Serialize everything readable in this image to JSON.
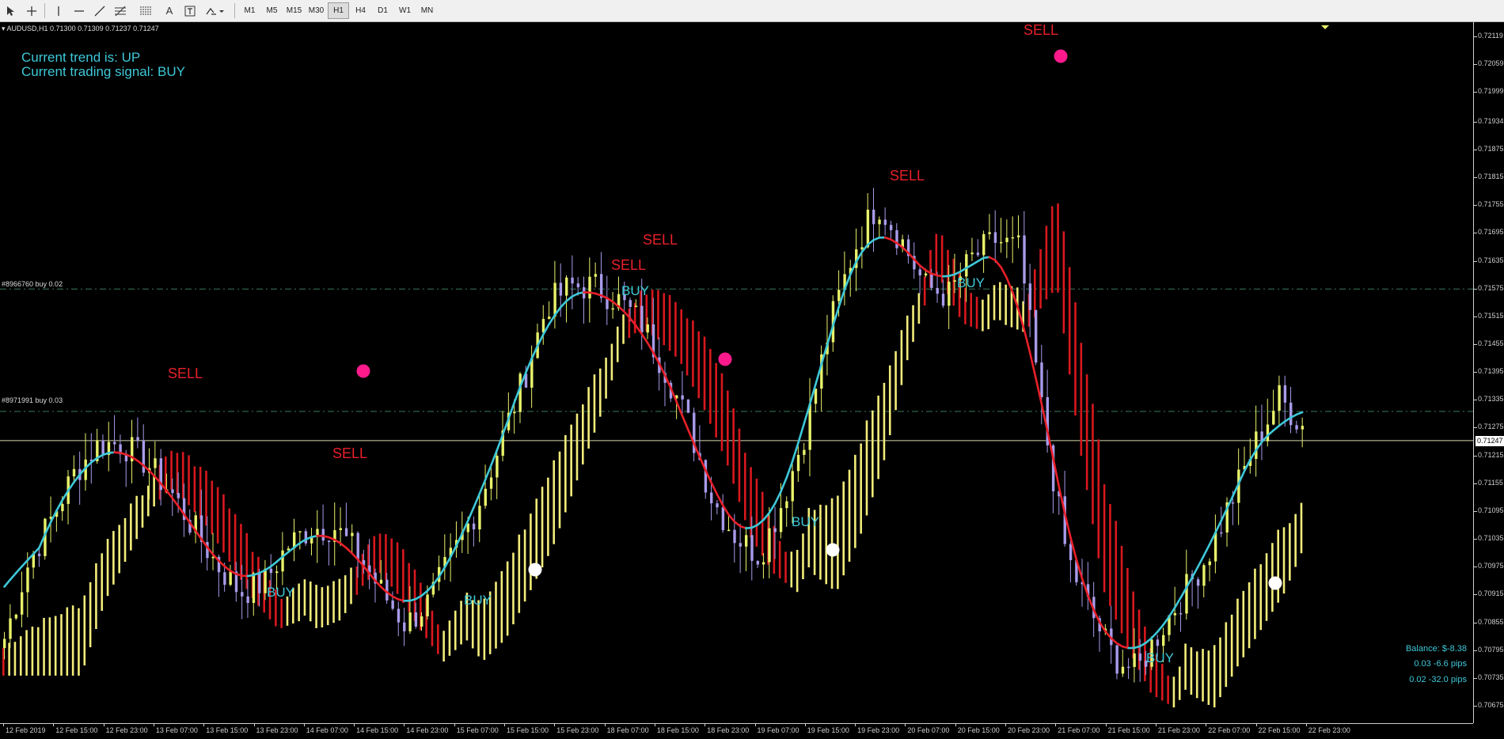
{
  "toolbar": {
    "tools": [
      "cursor-icon",
      "crosshair-icon",
      "vertical-line-icon",
      "horizontal-line-icon",
      "trendline-icon",
      "fibonacci-icon",
      "channel-icon",
      "text-icon",
      "text-label-icon",
      "shapes-icon"
    ],
    "timeframes": [
      "M1",
      "M5",
      "M15",
      "M30",
      "H1",
      "H4",
      "D1",
      "W1",
      "MN"
    ],
    "active_timeframe": "H1"
  },
  "chart": {
    "symbol_line": "AUDUSD,H1  0.71300 0.71309 0.71237 0.71247",
    "trend_text": "Current trend is: UP",
    "signal_text": "Current trading signal: BUY",
    "current_price": "0.71247",
    "orders": [
      {
        "label": "#8966760 buy 0.02",
        "price": 0.71574
      },
      {
        "label": "#8971991 buy 0.03",
        "price": 0.7131
      }
    ],
    "signals": [
      {
        "text": "SELL",
        "type": "sell"
      },
      {
        "text": "SELL",
        "type": "sell"
      },
      {
        "text": "SELL",
        "type": "sell"
      },
      {
        "text": "SELL",
        "type": "sell"
      },
      {
        "text": "SELL",
        "type": "sell"
      },
      {
        "text": "SELL",
        "type": "sell"
      },
      {
        "text": "BUY",
        "type": "buy"
      },
      {
        "text": "BUY",
        "type": "buy"
      },
      {
        "text": "BUY",
        "type": "buy"
      },
      {
        "text": "BUY",
        "type": "buy"
      },
      {
        "text": "BUY",
        "type": "buy"
      },
      {
        "text": "BUY",
        "type": "buy"
      }
    ],
    "balance": "Balance: $-8.38",
    "pips_1": "0.03 -6.6 pips",
    "pips_2": "0.02 -32.0 pips"
  },
  "price_axis": [
    "0.72119",
    "0.72059",
    "0.71999",
    "0.71934",
    "0.71875",
    "0.71815",
    "0.71755",
    "0.71695",
    "0.71635",
    "0.71575",
    "0.71515",
    "0.71455",
    "0.71395",
    "0.71335",
    "0.71275",
    "0.71215",
    "0.71155",
    "0.71095",
    "0.71035",
    "0.70975",
    "0.70915",
    "0.70855",
    "0.70795",
    "0.70735",
    "0.70675"
  ],
  "time_axis": [
    "12 Feb 2019",
    "12 Feb 15:00",
    "12 Feb 23:00",
    "13 Feb 07:00",
    "13 Feb 15:00",
    "13 Feb 23:00",
    "14 Feb 07:00",
    "14 Feb 15:00",
    "14 Feb 23:00",
    "15 Feb 07:00",
    "15 Feb 15:00",
    "15 Feb 23:00",
    "18 Feb 07:00",
    "18 Feb 15:00",
    "18 Feb 23:00",
    "19 Feb 07:00",
    "19 Feb 15:00",
    "19 Feb 23:00",
    "20 Feb 07:00",
    "20 Feb 15:00",
    "20 Feb 23:00",
    "21 Feb 07:00",
    "21 Feb 15:00",
    "21 Feb 23:00",
    "22 Feb 07:00",
    "22 Feb 15:00",
    "22 Feb 23:00"
  ],
  "colors": {
    "background": "#000000",
    "bull_candle": "#e8f26a",
    "bear_candle": "#a99bea",
    "trend_up": "#3ec8d8",
    "trend_down": "#e8202a",
    "band_up": "#f2ec7a",
    "band_down": "#d8181e",
    "sell_dot": "#ff1a8c",
    "buy_dot": "#ffffff"
  },
  "chart_data": {
    "type": "candlestick",
    "symbol": "AUDUSD",
    "timeframe": "H1",
    "ylim": [
      0.70675,
      0.72119
    ],
    "x": [
      "12 Feb 2019",
      "12 Feb 15:00",
      "12 Feb 23:00",
      "13 Feb 07:00",
      "13 Feb 15:00",
      "13 Feb 23:00",
      "14 Feb 07:00",
      "14 Feb 15:00",
      "14 Feb 23:00",
      "15 Feb 07:00",
      "15 Feb 15:00",
      "15 Feb 23:00",
      "18 Feb 07:00",
      "18 Feb 15:00",
      "18 Feb 23:00",
      "19 Feb 07:00",
      "19 Feb 15:00",
      "19 Feb 23:00",
      "20 Feb 07:00",
      "20 Feb 15:00",
      "20 Feb 23:00",
      "21 Feb 07:00",
      "21 Feb 15:00",
      "21 Feb 23:00",
      "22 Feb 07:00",
      "22 Feb 15:00",
      "22 Feb 23:00"
    ],
    "close_path": [
      0.7082,
      0.7098,
      0.7108,
      0.7118,
      0.7124,
      0.7124,
      0.712,
      0.7114,
      0.7106,
      0.7098,
      0.7092,
      0.7094,
      0.7102,
      0.7106,
      0.7106,
      0.71,
      0.7092,
      0.7085,
      0.709,
      0.71,
      0.711,
      0.7124,
      0.7138,
      0.7154,
      0.7158,
      0.7158,
      0.7155,
      0.715,
      0.714,
      0.7128,
      0.7112,
      0.7104,
      0.71,
      0.7112,
      0.7128,
      0.715,
      0.7166,
      0.7176,
      0.7168,
      0.7158,
      0.7156,
      0.7164,
      0.7168,
      0.7166,
      0.713,
      0.71,
      0.7088,
      0.7078,
      0.7075,
      0.7084,
      0.7092,
      0.71,
      0.7112,
      0.7124,
      0.7134,
      0.7128
    ]
  }
}
